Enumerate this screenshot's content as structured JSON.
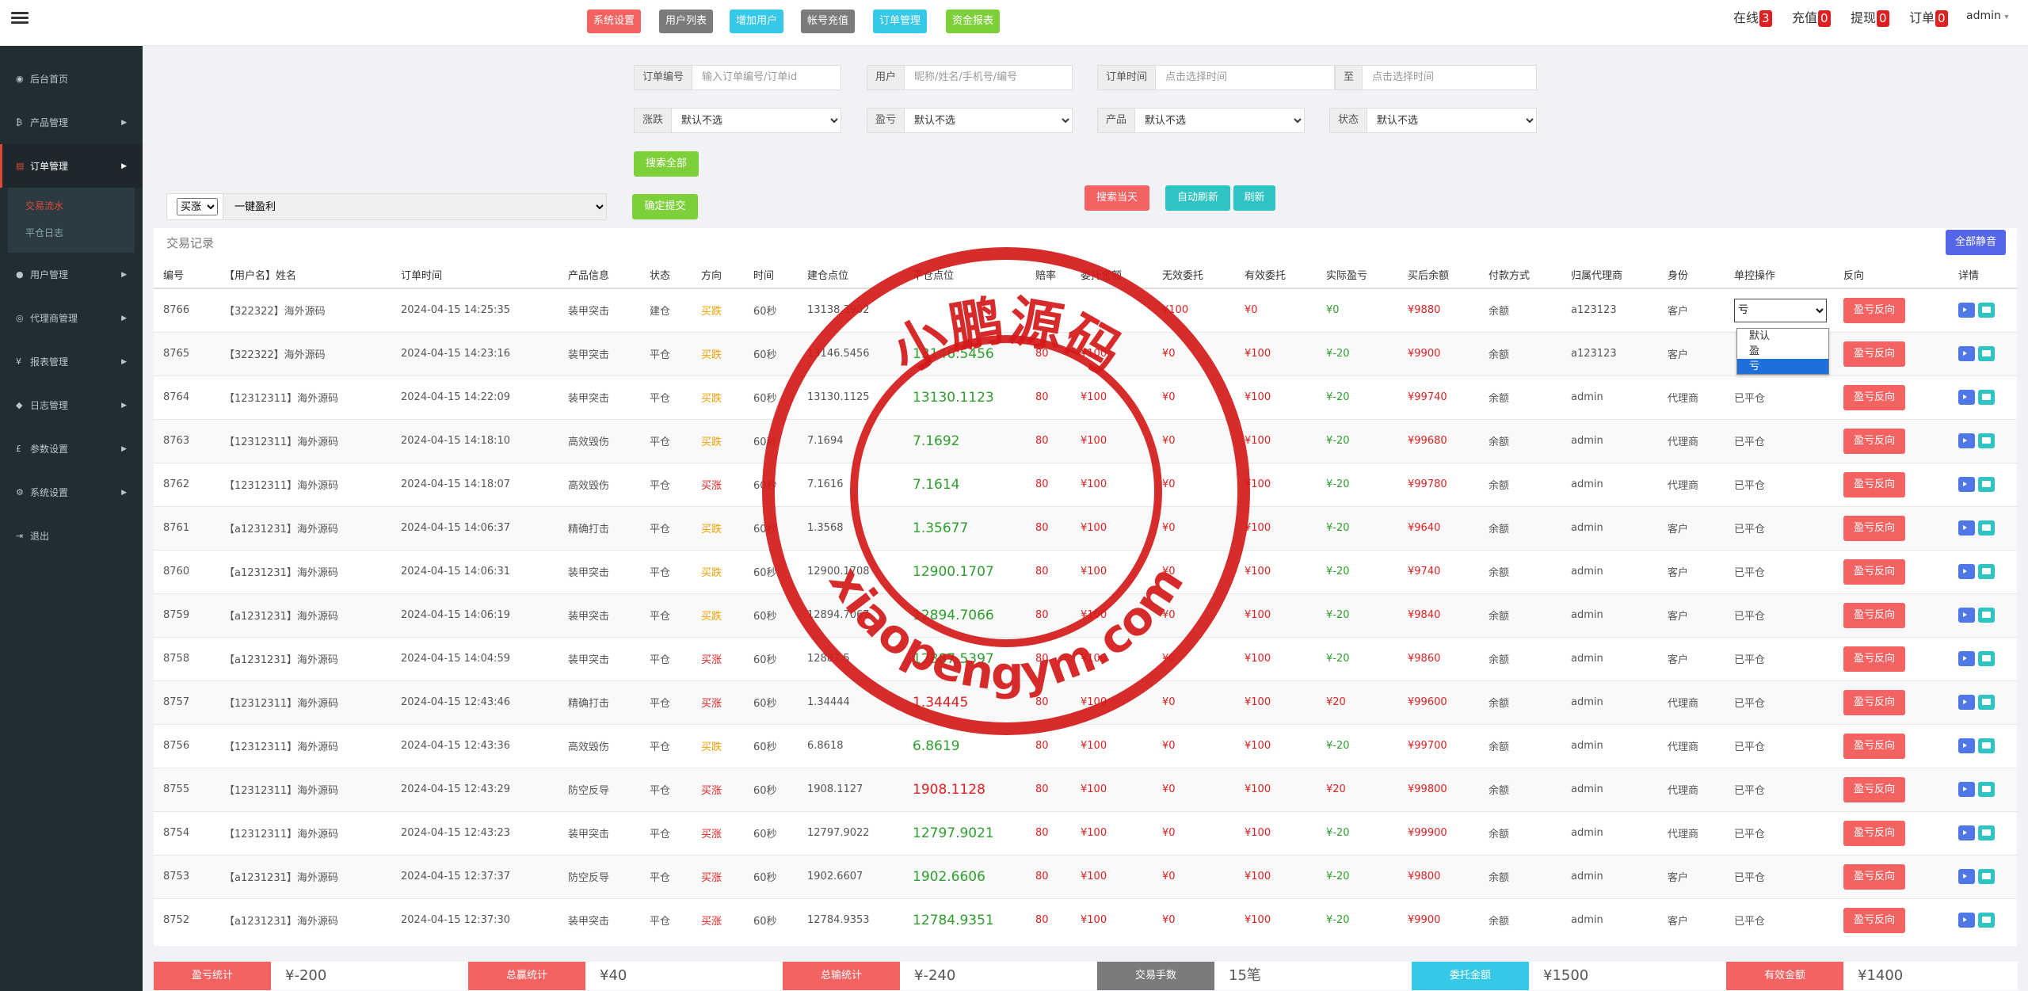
{
  "colors": {
    "red": "#f46262",
    "grey": "#7b7b7b",
    "cyan": "#35c8e8",
    "green": "#7ed03a",
    "stamp": "#d41a1a",
    "sidebar": "#222d32",
    "purple": "#5566ea"
  },
  "topnav": [
    "系统设置",
    "用户列表",
    "增加用户",
    "帐号充值",
    "订单管理",
    "资金报表"
  ],
  "top_status": [
    {
      "label": "在线",
      "count": "3"
    },
    {
      "label": "充值",
      "count": "0"
    },
    {
      "label": "提现",
      "count": "0"
    },
    {
      "label": "订单",
      "count": "0"
    }
  ],
  "admin": "admin",
  "admin_caret": "▾",
  "sidebar": {
    "items": [
      {
        "label": "后台首页",
        "icon": "dashboard-icon",
        "glyph": "◉"
      },
      {
        "label": "产品管理",
        "icon": "bitcoin-icon",
        "glyph": "₿"
      },
      {
        "label": "订单管理",
        "icon": "copy-icon",
        "glyph": "▤"
      },
      {
        "label": "用户管理",
        "icon": "user-icon",
        "glyph": "●"
      },
      {
        "label": "代理商管理",
        "icon": "users-icon",
        "glyph": "◎"
      },
      {
        "label": "报表管理",
        "icon": "yen-icon",
        "glyph": "¥"
      },
      {
        "label": "日志管理",
        "icon": "tag-icon",
        "glyph": "◆"
      },
      {
        "label": "参数设置",
        "icon": "pound-icon",
        "glyph": "£"
      },
      {
        "label": "系统设置",
        "icon": "cogs-icon",
        "glyph": "⚙"
      },
      {
        "label": "退出",
        "icon": "sign-out-icon",
        "glyph": "⇥"
      }
    ],
    "sub_items": [
      "交易流水",
      "平仓日志"
    ]
  },
  "filters": {
    "order_no": {
      "label": "订单编号",
      "placeholder": "输入订单编号/订单id"
    },
    "user": {
      "label": "用户",
      "placeholder": "昵称/姓名/手机号/编号"
    },
    "order_time": {
      "label": "订单时间",
      "placeholder": "点击选择时间"
    },
    "to": {
      "label": "至",
      "placeholder": "点击选择时间"
    },
    "rise_fall": {
      "label": "涨跌",
      "value": "默认不选"
    },
    "profit": {
      "label": "盈亏",
      "value": "默认不选"
    },
    "product": {
      "label": "产品",
      "value": "默认不选"
    },
    "status": {
      "label": "状态",
      "value": "默认不选"
    }
  },
  "search_all": "搜索全部",
  "bulk": {
    "direction": "买涨",
    "action": "一键盈利",
    "submit": "确定提交"
  },
  "actions": {
    "search_today": "搜索当天",
    "auto_refresh": "自动刷新",
    "refresh": "刷新",
    "mute_all": "全部静音"
  },
  "table": {
    "title": "交易记录",
    "headers": [
      "编号",
      "【用户名】姓名",
      "订单时间",
      "产品信息",
      "状态",
      "方向",
      "时间",
      "建仓点位",
      "平仓点位",
      "赔率",
      "委托金额",
      "无效委托",
      "有效委托",
      "实际盈亏",
      "买后余额",
      "付款方式",
      "归属代理商",
      "身份",
      "单控操作",
      "反向",
      "详情"
    ],
    "rows": [
      {
        "id": "8766",
        "user": "【322322】海外源码",
        "time": "2024-04-15 14:25:35",
        "product": "装甲突击",
        "status": "建仓",
        "dir": "买跌",
        "dur": "60秒",
        "open": "13138.3902",
        "close": "",
        "rate": "",
        "amount": "",
        "invalid": "¥100",
        "valid": "¥0",
        "pl": "¥0",
        "balance": "¥9880",
        "pay": "余额",
        "agent": "a123123",
        "role": "客户",
        "ctl": "亏",
        "rev": "盈亏反向"
      },
      {
        "id": "8765",
        "user": "【322322】海外源码",
        "time": "2024-04-15 14:23:16",
        "product": "装甲突击",
        "status": "平仓",
        "dir": "买跌",
        "dur": "60秒",
        "open": "13146.5456",
        "close": "13146.5456",
        "rate": "80",
        "amount": "¥100",
        "invalid": "¥0",
        "valid": "¥100",
        "pl": "¥-20",
        "balance": "¥9900",
        "pay": "余额",
        "agent": "a123123",
        "role": "客户",
        "ctl": "",
        "rev": "盈亏反向"
      },
      {
        "id": "8764",
        "user": "【12312311】海外源码",
        "time": "2024-04-15 14:22:09",
        "product": "装甲突击",
        "status": "平仓",
        "dir": "买跌",
        "dur": "60秒",
        "open": "13130.1125",
        "close": "13130.1123",
        "rate": "80",
        "amount": "¥100",
        "invalid": "¥0",
        "valid": "¥100",
        "pl": "¥-20",
        "balance": "¥99740",
        "pay": "余额",
        "agent": "admin",
        "role": "代理商",
        "ctl": "已平仓",
        "rev": "盈亏反向"
      },
      {
        "id": "8763",
        "user": "【12312311】海外源码",
        "time": "2024-04-15 14:18:10",
        "product": "高效毁伤",
        "status": "平仓",
        "dir": "买跌",
        "dur": "60秒",
        "open": "7.1694",
        "close": "7.1692",
        "rate": "80",
        "amount": "¥100",
        "invalid": "¥0",
        "valid": "¥100",
        "pl": "¥-20",
        "balance": "¥99680",
        "pay": "余额",
        "agent": "admin",
        "role": "代理商",
        "ctl": "已平仓",
        "rev": "盈亏反向"
      },
      {
        "id": "8762",
        "user": "【12312311】海外源码",
        "time": "2024-04-15 14:18:07",
        "product": "高效毁伤",
        "status": "平仓",
        "dir": "买涨",
        "dur": "60秒",
        "open": "7.1616",
        "close": "7.1614",
        "rate": "80",
        "amount": "¥100",
        "invalid": "¥0",
        "valid": "¥100",
        "pl": "¥-20",
        "balance": "¥99780",
        "pay": "余额",
        "agent": "admin",
        "role": "代理商",
        "ctl": "已平仓",
        "rev": "盈亏反向"
      },
      {
        "id": "8761",
        "user": "【a1231231】海外源码",
        "time": "2024-04-15 14:06:37",
        "product": "精确打击",
        "status": "平仓",
        "dir": "买跌",
        "dur": "60秒",
        "open": "1.3568",
        "close": "1.35677",
        "rate": "80",
        "amount": "¥100",
        "invalid": "¥0",
        "valid": "¥100",
        "pl": "¥-20",
        "balance": "¥9640",
        "pay": "余额",
        "agent": "admin",
        "role": "客户",
        "ctl": "已平仓",
        "rev": "盈亏反向"
      },
      {
        "id": "8760",
        "user": "【a1231231】海外源码",
        "time": "2024-04-15 14:06:31",
        "product": "装甲突击",
        "status": "平仓",
        "dir": "买跌",
        "dur": "60秒",
        "open": "12900.1708",
        "close": "12900.1707",
        "rate": "80",
        "amount": "¥100",
        "invalid": "¥0",
        "valid": "¥100",
        "pl": "¥-20",
        "balance": "¥9740",
        "pay": "余额",
        "agent": "admin",
        "role": "客户",
        "ctl": "已平仓",
        "rev": "盈亏反向"
      },
      {
        "id": "8759",
        "user": "【a1231231】海外源码",
        "time": "2024-04-15 14:06:19",
        "product": "装甲突击",
        "status": "平仓",
        "dir": "买跌",
        "dur": "60秒",
        "open": "12894.7067",
        "close": "12894.7066",
        "rate": "80",
        "amount": "¥100",
        "invalid": "¥0",
        "valid": "¥100",
        "pl": "¥-20",
        "balance": "¥9840",
        "pay": "余额",
        "agent": "admin",
        "role": "客户",
        "ctl": "已平仓",
        "rev": "盈亏反向"
      },
      {
        "id": "8758",
        "user": "【a1231231】海外源码",
        "time": "2024-04-15 14:04:59",
        "product": "装甲突击",
        "status": "平仓",
        "dir": "买涨",
        "dur": "60秒",
        "open": "12887.5",
        "close": "12887.5397",
        "rate": "80",
        "amount": "¥100",
        "invalid": "¥0",
        "valid": "¥100",
        "pl": "¥-20",
        "balance": "¥9860",
        "pay": "余额",
        "agent": "admin",
        "role": "客户",
        "ctl": "已平仓",
        "rev": "盈亏反向"
      },
      {
        "id": "8757",
        "user": "【12312311】海外源码",
        "time": "2024-04-15 12:43:46",
        "product": "精确打击",
        "status": "平仓",
        "dir": "买涨",
        "dur": "60秒",
        "open": "1.34444",
        "close": "1.34445",
        "rate": "80",
        "amount": "¥100",
        "invalid": "¥0",
        "valid": "¥100",
        "pl": "¥20",
        "balance": "¥99600",
        "pay": "余额",
        "agent": "admin",
        "role": "代理商",
        "ctl": "已平仓",
        "rev": "盈亏反向"
      },
      {
        "id": "8756",
        "user": "【12312311】海外源码",
        "time": "2024-04-15 12:43:36",
        "product": "高效毁伤",
        "status": "平仓",
        "dir": "买跌",
        "dur": "60秒",
        "open": "6.8618",
        "close": "6.8619",
        "rate": "80",
        "amount": "¥100",
        "invalid": "¥0",
        "valid": "¥100",
        "pl": "¥-20",
        "balance": "¥99700",
        "pay": "余额",
        "agent": "admin",
        "role": "代理商",
        "ctl": "已平仓",
        "rev": "盈亏反向"
      },
      {
        "id": "8755",
        "user": "【12312311】海外源码",
        "time": "2024-04-15 12:43:29",
        "product": "防空反导",
        "status": "平仓",
        "dir": "买涨",
        "dur": "60秒",
        "open": "1908.1127",
        "close": "1908.1128",
        "rate": "80",
        "amount": "¥100",
        "invalid": "¥0",
        "valid": "¥100",
        "pl": "¥20",
        "balance": "¥99800",
        "pay": "余额",
        "agent": "admin",
        "role": "代理商",
        "ctl": "已平仓",
        "rev": "盈亏反向"
      },
      {
        "id": "8754",
        "user": "【12312311】海外源码",
        "time": "2024-04-15 12:43:23",
        "product": "装甲突击",
        "status": "平仓",
        "dir": "买涨",
        "dur": "60秒",
        "open": "12797.9022",
        "close": "12797.9021",
        "rate": "80",
        "amount": "¥100",
        "invalid": "¥0",
        "valid": "¥100",
        "pl": "¥-20",
        "balance": "¥99900",
        "pay": "余额",
        "agent": "admin",
        "role": "代理商",
        "ctl": "已平仓",
        "rev": "盈亏反向"
      },
      {
        "id": "8753",
        "user": "【a1231231】海外源码",
        "time": "2024-04-15 12:37:37",
        "product": "防空反导",
        "status": "平仓",
        "dir": "买涨",
        "dur": "60秒",
        "open": "1902.6607",
        "close": "1902.6606",
        "rate": "80",
        "amount": "¥100",
        "invalid": "¥0",
        "valid": "¥100",
        "pl": "¥-20",
        "balance": "¥9800",
        "pay": "余额",
        "agent": "admin",
        "role": "客户",
        "ctl": "已平仓",
        "rev": "盈亏反向"
      },
      {
        "id": "8752",
        "user": "【a1231231】海外源码",
        "time": "2024-04-15 12:37:30",
        "product": "装甲突击",
        "status": "平仓",
        "dir": "买涨",
        "dur": "60秒",
        "open": "12784.9353",
        "close": "12784.9351",
        "rate": "80",
        "amount": "¥100",
        "invalid": "¥0",
        "valid": "¥100",
        "pl": "¥-20",
        "balance": "¥9900",
        "pay": "余额",
        "agent": "admin",
        "role": "客户",
        "ctl": "已平仓",
        "rev": "盈亏反向"
      }
    ]
  },
  "control_dropdown": {
    "options": [
      "默认",
      "盈",
      "亏"
    ],
    "selected": "亏"
  },
  "stats": [
    {
      "label": "盈亏统计",
      "value": "¥-200",
      "color": "#f46262"
    },
    {
      "label": "总赢统计",
      "value": "¥40",
      "color": "#f46262"
    },
    {
      "label": "总输统计",
      "value": "¥-240",
      "color": "#f46262"
    },
    {
      "label": "交易手数",
      "value": "15笔",
      "color": "#7b7b7b"
    },
    {
      "label": "委托金额",
      "value": "¥1500",
      "color": "#35c8e8"
    },
    {
      "label": "有效金额",
      "value": "¥1400",
      "color": "#f46262"
    }
  ],
  "watermark": {
    "top": "小鹏源码",
    "bottom": "xiaopengym.com"
  }
}
